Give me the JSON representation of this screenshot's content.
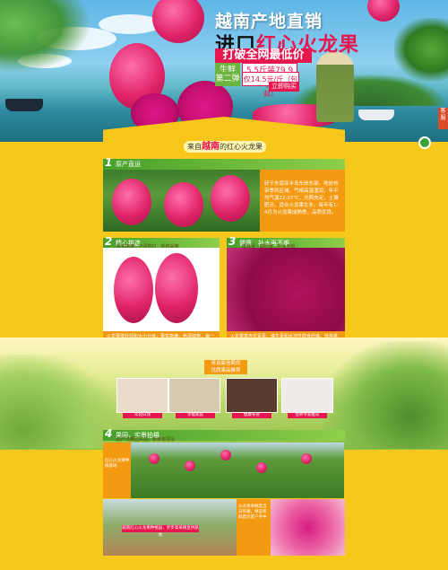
{
  "hero": {
    "title_line1": "越南产地直销",
    "title_line2_prefix": "进口",
    "title_line2_highlight": "红心火龙果",
    "banner": "打破全网最低价",
    "tag1": "生鲜",
    "price1": "5.5斤装79.9元",
    "tag2": "第二弹",
    "price2": "仅14.5元/斤（包邮）",
    "buy_button": "立即购买",
    "side_badge": "客服"
  },
  "strip": {
    "prefix": "来自",
    "emphasis": "越南",
    "suffix": "的红心火龙果"
  },
  "section1": {
    "num": "1",
    "title": "原产直运",
    "text": "好于东南亚半岛东岸东部，地处热带季风区域，气候高温湿润，年平均气温22-27℃，光照充足，土壤肥沃，适合火龙果生长，每年有1-4月为火龙果成熟季，品质优良。"
  },
  "section2": {
    "num": "2",
    "title": "精心挑选",
    "subtitle": "果实饱满 · 色泽鲜红 · 新鲜采摘",
    "text": "火龙果按外观和大小分级，果实饱满，色泽鲜艳，每一颗都经过精心挑选，保证新鲜美味。"
  },
  "section3": {
    "num": "3",
    "title": "健康、补水再不难",
    "subtitle": "低热量 · 高纤维 · 补水养颜",
    "text": "火龙果富含花青素、维生素和水溶性膳食纤维，低热量高营养，是爱美人士补水养颜的理想水果。"
  },
  "endorsement": {
    "tag1": "来自最信赖的",
    "tag2": "优质果品推荐",
    "people": [
      {
        "caption": "年轻白领"
      },
      {
        "caption": "幸福家庭"
      },
      {
        "caption": "健康长者"
      },
      {
        "caption": "营养专家推荐"
      }
    ]
  },
  "section4": {
    "num": "4",
    "title": "果园，实景拍摄",
    "subtitle": "原产地果园实拍，新鲜看得见",
    "side_text": "红心火龙果种植基地",
    "side_text2": "火龙果采摘后当日装箱，保证新鲜直达客户手中",
    "banner": "越南红心火龙果种植园，步步高采摘直供基地"
  }
}
